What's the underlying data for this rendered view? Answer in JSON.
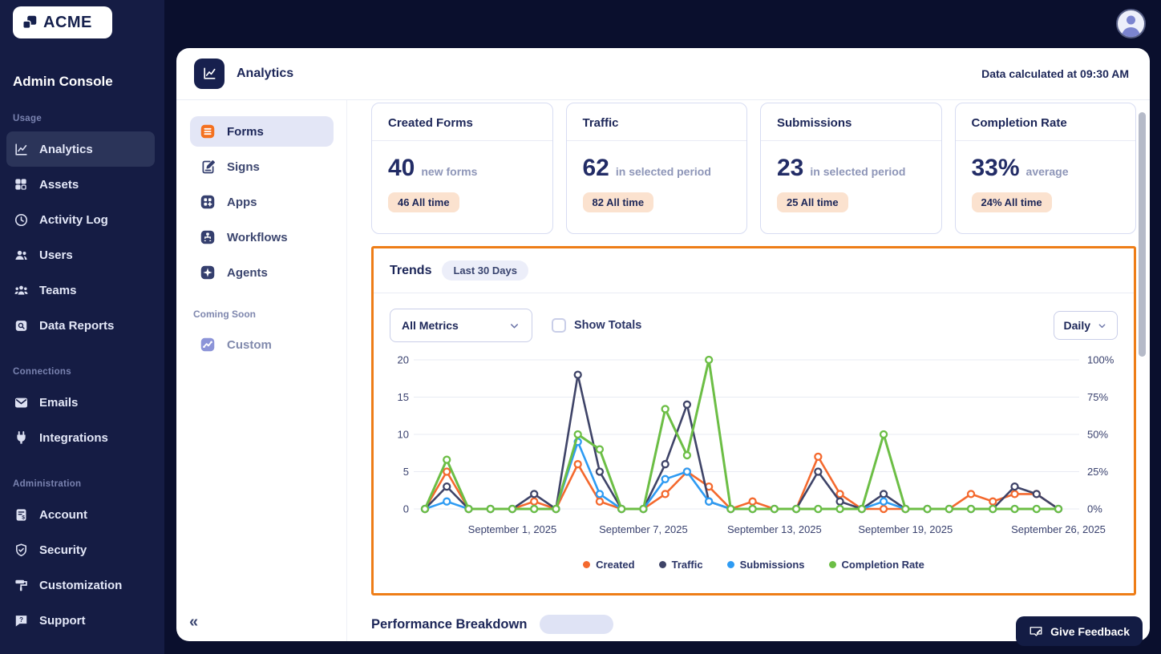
{
  "topbar": {
    "logo_text": "ACME"
  },
  "sidebar": {
    "title": "Admin Console",
    "sections": [
      {
        "label": "Usage",
        "items": [
          {
            "label": "Analytics",
            "icon": "analytics-icon",
            "active": true
          },
          {
            "label": "Assets",
            "icon": "assets-icon"
          },
          {
            "label": "Activity Log",
            "icon": "activity-log-icon"
          },
          {
            "label": "Users",
            "icon": "users-icon"
          },
          {
            "label": "Teams",
            "icon": "teams-icon"
          },
          {
            "label": "Data Reports",
            "icon": "data-reports-icon"
          }
        ]
      },
      {
        "label": "Connections",
        "items": [
          {
            "label": "Emails",
            "icon": "email-icon"
          },
          {
            "label": "Integrations",
            "icon": "plug-icon"
          }
        ]
      },
      {
        "label": "Administration",
        "items": [
          {
            "label": "Account",
            "icon": "billing-icon"
          },
          {
            "label": "Security",
            "icon": "shield-icon"
          },
          {
            "label": "Customization",
            "icon": "paint-roller-icon"
          },
          {
            "label": "Support",
            "icon": "help-chat-icon"
          }
        ]
      }
    ]
  },
  "header": {
    "title": "Analytics",
    "status": "Data calculated at 09:30 AM"
  },
  "subnav": {
    "items": [
      {
        "label": "Forms",
        "active": true
      },
      {
        "label": "Signs"
      },
      {
        "label": "Apps"
      },
      {
        "label": "Workflows"
      },
      {
        "label": "Agents"
      }
    ],
    "coming_soon_label": "Coming Soon",
    "coming_items": [
      {
        "label": "Custom"
      }
    ],
    "collapse_label": "«"
  },
  "stats": [
    {
      "title": "Created Forms",
      "value": "40",
      "unit": "new forms",
      "badge": "46 All time"
    },
    {
      "title": "Traffic",
      "value": "62",
      "unit": "in selected period",
      "badge": "82 All time"
    },
    {
      "title": "Submissions",
      "value": "23",
      "unit": "in selected period",
      "badge": "25 All time"
    },
    {
      "title": "Completion Rate",
      "value": "33%",
      "unit": "average",
      "badge": "24% All time"
    }
  ],
  "trends": {
    "title": "Trends",
    "period_badge": "Last 30 Days",
    "metric_select": "All Metrics",
    "show_totals_label": "Show Totals",
    "show_totals_checked": false,
    "interval_select": "Daily"
  },
  "chart_data": {
    "type": "line",
    "grid": true,
    "legend_position": "bottom",
    "dates": [
      "2025-08-28",
      "2025-08-29",
      "2025-08-30",
      "2025-08-31",
      "2025-09-01",
      "2025-09-02",
      "2025-09-03",
      "2025-09-04",
      "2025-09-05",
      "2025-09-06",
      "2025-09-07",
      "2025-09-08",
      "2025-09-09",
      "2025-09-10",
      "2025-09-11",
      "2025-09-12",
      "2025-09-13",
      "2025-09-14",
      "2025-09-15",
      "2025-09-16",
      "2025-09-17",
      "2025-09-18",
      "2025-09-19",
      "2025-09-20",
      "2025-09-21",
      "2025-09-22",
      "2025-09-23",
      "2025-09-24",
      "2025-09-25",
      "2025-09-26"
    ],
    "x_ticks": [
      {
        "index": 4,
        "label": "September 1, 2025"
      },
      {
        "index": 10,
        "label": "September 7, 2025"
      },
      {
        "index": 16,
        "label": "September 13, 2025"
      },
      {
        "index": 22,
        "label": "September 19, 2025"
      },
      {
        "index": 29,
        "label": "September 26, 2025"
      }
    ],
    "left_axis": {
      "range": [
        0,
        20
      ],
      "ticks": [
        0,
        5,
        10,
        15,
        20
      ]
    },
    "right_axis": {
      "range": [
        0,
        100
      ],
      "ticks": [
        "0%",
        "25%",
        "50%",
        "75%",
        "100%"
      ]
    },
    "series": [
      {
        "name": "Created",
        "color": "#F4692E",
        "axis": "left",
        "values": [
          0,
          5,
          0,
          0,
          0,
          1,
          0,
          6,
          1,
          0,
          0,
          2,
          5,
          3,
          0,
          1,
          0,
          0,
          7,
          2,
          0,
          0,
          0,
          0,
          0,
          2,
          1,
          2,
          2,
          0
        ]
      },
      {
        "name": "Traffic",
        "color": "#3F4468",
        "axis": "left",
        "values": [
          0,
          3,
          0,
          0,
          0,
          2,
          0,
          18,
          5,
          0,
          0,
          6,
          14,
          1,
          0,
          0,
          0,
          0,
          5,
          1,
          0,
          2,
          0,
          0,
          0,
          0,
          0,
          3,
          2,
          0
        ]
      },
      {
        "name": "Submissions",
        "color": "#2E9BF3",
        "axis": "left",
        "values": [
          0,
          1,
          0,
          0,
          0,
          0,
          0,
          9,
          2,
          0,
          0,
          4,
          5,
          1,
          0,
          0,
          0,
          0,
          0,
          0,
          0,
          1,
          0,
          0,
          0,
          0,
          0,
          0,
          0,
          0
        ]
      },
      {
        "name": "Completion Rate",
        "color": "#6CBE45",
        "axis": "right",
        "values": [
          0,
          33,
          0,
          0,
          0,
          0,
          0,
          50,
          40,
          0,
          0,
          67,
          36,
          100,
          0,
          0,
          0,
          0,
          0,
          0,
          0,
          50,
          0,
          0,
          0,
          0,
          0,
          0,
          0,
          0
        ]
      }
    ]
  },
  "next_section": {
    "title": "Performance Breakdown"
  },
  "feedback": {
    "label": "Give Feedback"
  },
  "colors": {
    "highlight": "#EE7D17",
    "badge_bg": "#FBE2CF",
    "navy": "#151C44"
  }
}
